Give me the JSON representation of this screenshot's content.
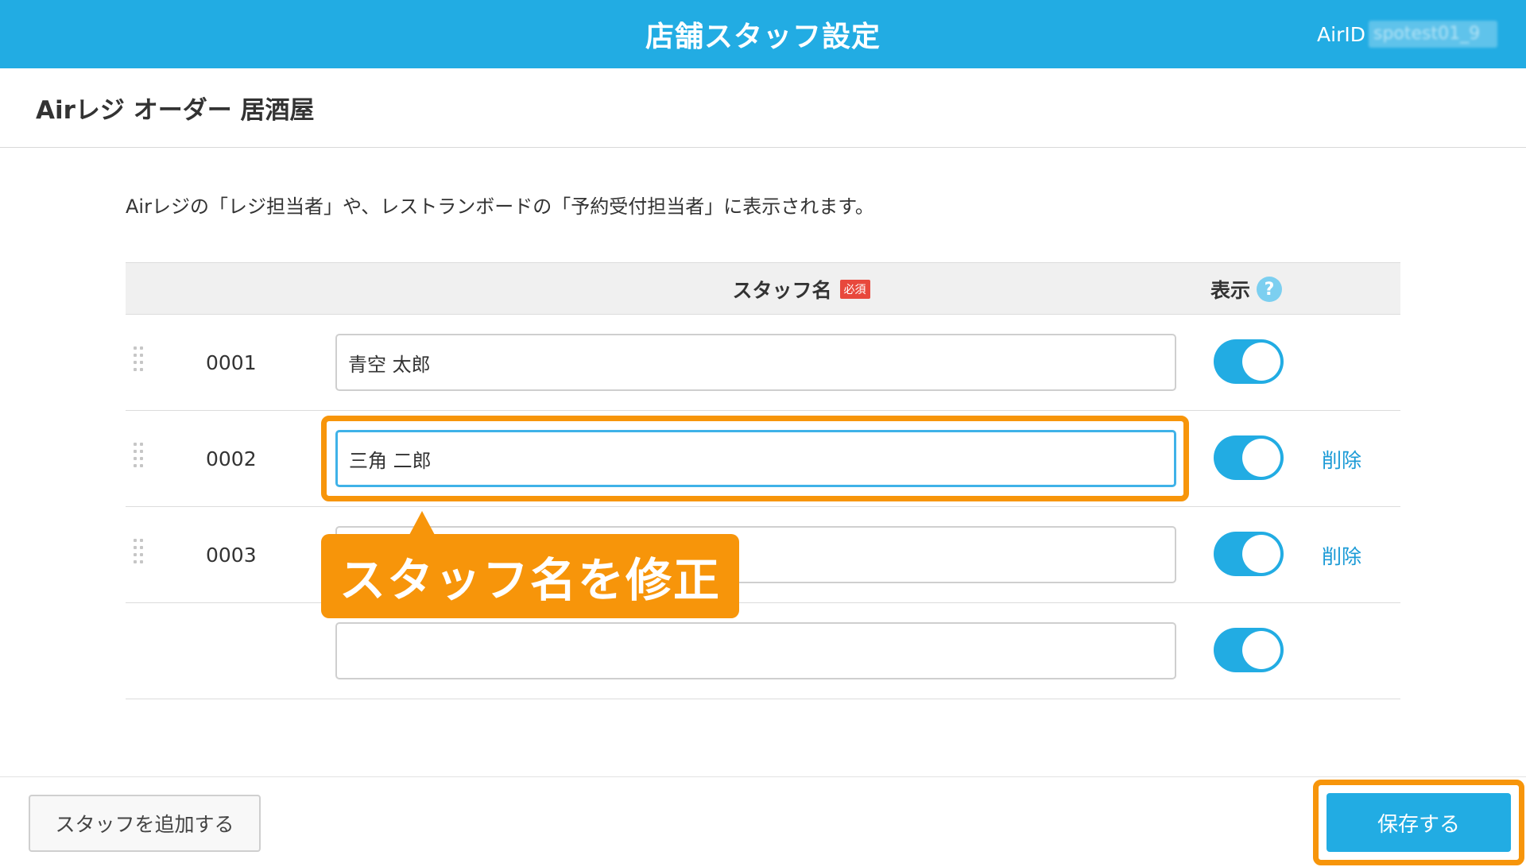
{
  "header": {
    "title": "店舗スタッフ設定",
    "airid_label": "AirID",
    "airid_value": "spotest01_9"
  },
  "store": {
    "name": "Airレジ オーダー 居酒屋"
  },
  "description": "Airレジの「レジ担当者」や、レストランボードの「予約受付担当者」に表示されます。",
  "table": {
    "col_name": "スタッフ名",
    "required_badge": "必須",
    "col_display": "表示",
    "help_glyph": "?",
    "rows": [
      {
        "code": "0001",
        "name": "青空 太郎",
        "display": true,
        "delete_label": ""
      },
      {
        "code": "0002",
        "name": "三角 二郎",
        "display": true,
        "delete_label": "削除"
      },
      {
        "code": "0003",
        "name": "",
        "display": true,
        "delete_label": "削除"
      },
      {
        "code": "",
        "name": "",
        "display": true,
        "delete_label": ""
      }
    ]
  },
  "callout": {
    "text": "スタッフ名を修正"
  },
  "footer": {
    "add_label": "スタッフを追加する",
    "save_label": "保存する"
  },
  "colors": {
    "brand": "#22ace3",
    "highlight": "#f7950a",
    "delete_link": "#1a9ad6",
    "required": "#e8483c"
  },
  "icons": [
    "drag-handle-icon",
    "help-icon",
    "toggle-switch"
  ]
}
